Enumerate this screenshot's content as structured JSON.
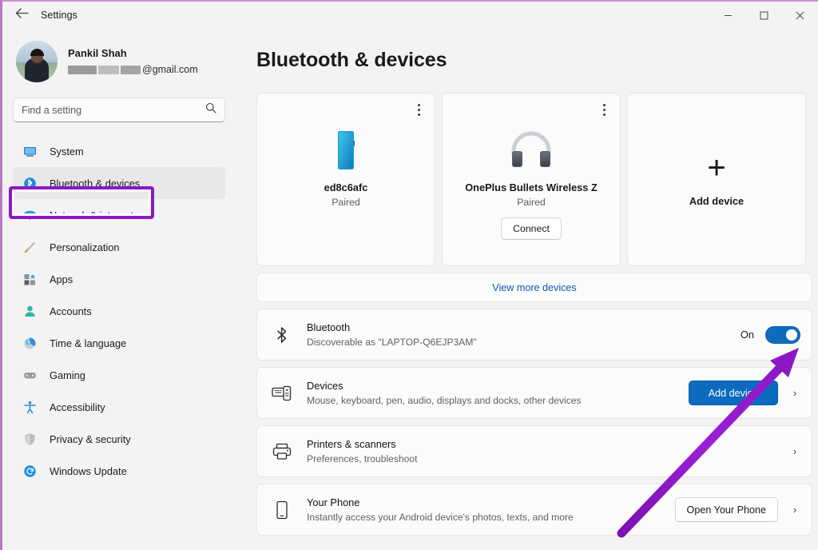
{
  "window": {
    "app_title": "Settings",
    "back_icon": "back-arrow-icon",
    "minimize_label": "—",
    "maximize_label": "☐",
    "close_label": "✕"
  },
  "account": {
    "name": "Pankil Shah",
    "email_suffix": "@gmail.com",
    "email_redacted": true
  },
  "search": {
    "placeholder": "Find a setting",
    "value": "",
    "icon": "search-icon"
  },
  "sidebar": {
    "items": [
      {
        "label": "System",
        "icon": "monitor-icon",
        "active": false
      },
      {
        "label": "Bluetooth & devices",
        "icon": "bluetooth-icon",
        "active": true
      },
      {
        "label": "Network & internet",
        "icon": "wifi-icon",
        "active": false
      },
      {
        "label": "Personalization",
        "icon": "paintbrush-icon",
        "active": false
      },
      {
        "label": "Apps",
        "icon": "apps-icon",
        "active": false
      },
      {
        "label": "Accounts",
        "icon": "person-icon",
        "active": false
      },
      {
        "label": "Time & language",
        "icon": "clock-globe-icon",
        "active": false
      },
      {
        "label": "Gaming",
        "icon": "gamepad-icon",
        "active": false
      },
      {
        "label": "Accessibility",
        "icon": "accessibility-icon",
        "active": false
      },
      {
        "label": "Privacy & security",
        "icon": "shield-icon",
        "active": false
      },
      {
        "label": "Windows Update",
        "icon": "update-icon",
        "active": false
      }
    ]
  },
  "main": {
    "page_title": "Bluetooth & devices",
    "device_cards": [
      {
        "name": "ed8c6afc",
        "status": "Paired",
        "icon": "phone-icon",
        "action": null,
        "menu_icon": "more-options-icon"
      },
      {
        "name": "OnePlus Bullets Wireless Z",
        "status": "Paired",
        "icon": "headphones-icon",
        "action": "Connect",
        "menu_icon": "more-options-icon"
      }
    ],
    "add_device_card": {
      "label": "Add device",
      "icon": "plus-icon"
    },
    "view_more_devices": "View more devices",
    "rows": [
      {
        "title": "Bluetooth",
        "subtitle": "Discoverable as \"LAPTOP-Q6EJP3AM\"",
        "icon": "bluetooth-glyph-icon",
        "control": "toggle",
        "toggle_label": "On",
        "toggle_state": "on",
        "chevron": false
      },
      {
        "title": "Devices",
        "subtitle": "Mouse, keyboard, pen, audio, displays and docks, other devices",
        "icon": "devices-icon",
        "control": "primary-button",
        "button_label": "Add device",
        "chevron": true
      },
      {
        "title": "Printers & scanners",
        "subtitle": "Preferences, troubleshoot",
        "icon": "printer-icon",
        "control": "none",
        "chevron": true
      },
      {
        "title": "Your Phone",
        "subtitle": "Instantly access your Android device's photos, texts, and more",
        "icon": "smartphone-icon",
        "control": "secondary-button",
        "button_label": "Open Your Phone",
        "chevron": true
      }
    ]
  },
  "annotations": {
    "highlight_color": "#8c18c4",
    "arrow_color": "#8c18c4",
    "highlight_target": "sidebar-item-bluetooth-devices",
    "arrow_target": "bluetooth-toggle"
  },
  "colors": {
    "accent_blue": "#0c6bbe",
    "toggle_blue": "#0f6cbd",
    "link_blue": "#0a5ca8",
    "window_bg": "#f3f3f3",
    "card_bg": "#fbfbfb"
  }
}
